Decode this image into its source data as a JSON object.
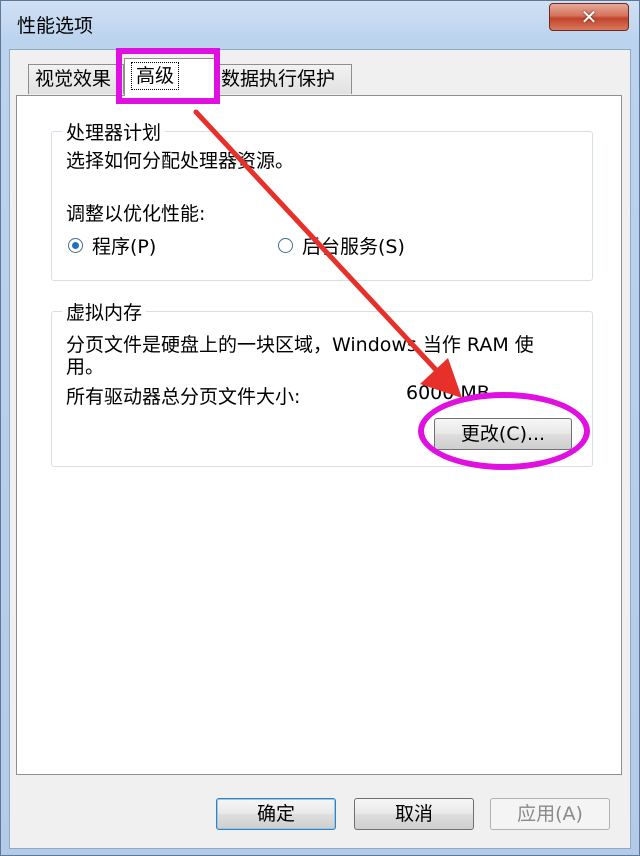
{
  "window": {
    "title": "性能选项",
    "close_glyph": "✕"
  },
  "tabs": [
    {
      "label": "视觉效果"
    },
    {
      "label": "高级"
    },
    {
      "label": "数据执行保护"
    }
  ],
  "processor": {
    "title": "处理器计划",
    "desc": "选择如何分配处理器资源。",
    "adjust_label": "调整以优化性能:",
    "option_programs": "程序(P)",
    "option_services": "后台服务(S)",
    "selected": "程序(P)"
  },
  "virtual_memory": {
    "title": "虚拟内存",
    "desc_line1": "分页文件是硬盘上的一块区域，Windows 当作 RAM 使",
    "desc_line2": "用。",
    "total_label": "所有驱动器总分页文件大小:",
    "total_value": "6000 MB",
    "change_button": "更改(C)..."
  },
  "footer": {
    "ok": "确定",
    "cancel": "取消",
    "apply": "应用(A)"
  },
  "annotations": {
    "color": "#e010e0",
    "arrow_color": "#e8302a"
  }
}
